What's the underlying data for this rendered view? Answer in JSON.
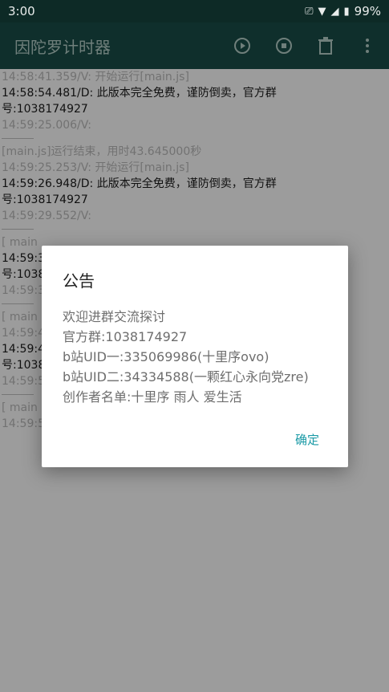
{
  "status_bar": {
    "time": "3:00",
    "battery": "99%",
    "icons": [
      "cast-icon",
      "wifi-icon",
      "signal-icon",
      "battery-icon"
    ]
  },
  "app_bar": {
    "title": "因陀罗计时器",
    "actions": [
      "run-icon",
      "stop-icon",
      "delete-icon",
      "more-icon"
    ]
  },
  "log": {
    "lines": [
      {
        "level": "v",
        "text": "14:58:41.359/V: 开始运行[main.js]"
      },
      {
        "level": "d",
        "text": "14:58:54.481/D: 此版本完全免费，谨防倒卖，官方群号:1038174927"
      },
      {
        "level": "v",
        "text": "14:59:25.006/V:"
      },
      {
        "level": "sep",
        "text": ""
      },
      {
        "level": "v",
        "text": " [main.js]运行结束，用时43.645000秒"
      },
      {
        "level": "v",
        "text": "14:59:25.253/V: 开始运行[main.js]"
      },
      {
        "level": "d",
        "text": "14:59:26.948/D: 此版本完全免费，谨防倒卖，官方群号:1038174927"
      },
      {
        "level": "v",
        "text": "14:59:29.552/V:"
      },
      {
        "level": "sep",
        "text": ""
      },
      {
        "level": "v",
        "text": " [ main"
      },
      {
        "level": "d",
        "text": "14:59:3"
      },
      {
        "level": "d",
        "text": "号:1038"
      },
      {
        "level": "v",
        "text": "14:59:3"
      },
      {
        "level": "sep",
        "text": ""
      },
      {
        "level": "v",
        "text": " [ main"
      },
      {
        "level": "v",
        "text": "14:59:4"
      },
      {
        "level": "d",
        "text": "14:59:4"
      },
      {
        "level": "d",
        "text": "号:1038"
      },
      {
        "level": "v",
        "text": "14:59:5"
      },
      {
        "level": "sep",
        "text": ""
      },
      {
        "level": "v",
        "text": " [ main"
      },
      {
        "level": "v",
        "text": "14:59:59.718/V: 开始运行[main.js]"
      }
    ]
  },
  "dialog": {
    "title": "公告",
    "lines": [
      "欢迎进群交流探讨",
      "官方群:1038174927",
      "b站UID一:335069986(十里序ovo)",
      "b站UID二:34334588(一颗红心永向党zre)",
      "创作者名单:十里序 雨人 爱生活"
    ],
    "confirm_label": "确定"
  }
}
